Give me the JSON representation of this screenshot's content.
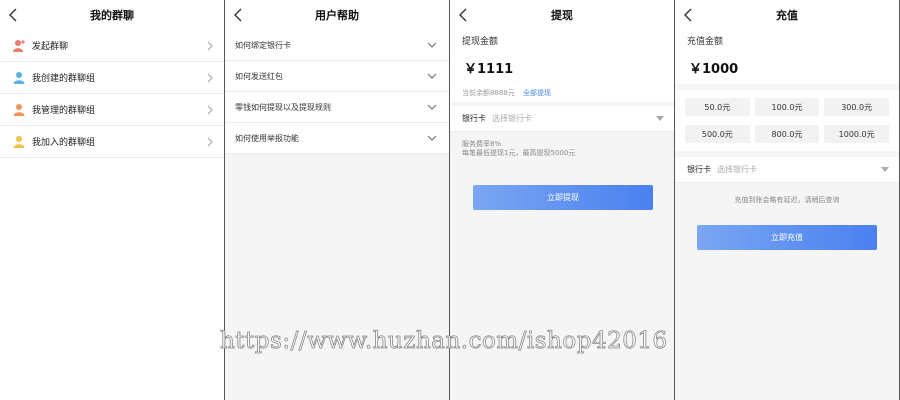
{
  "screens": {
    "my_groups": {
      "title": "我的群聊",
      "items": [
        {
          "label": "发起群聊",
          "icon": "user-add-icon",
          "color": "#e97b6a"
        },
        {
          "label": "我创建的群聊组",
          "icon": "user-icon",
          "color": "#5ab3e6"
        },
        {
          "label": "我管理的群聊组",
          "icon": "user-icon",
          "color": "#f0935a"
        },
        {
          "label": "我加入的群聊组",
          "icon": "user-icon",
          "color": "#f3c04a"
        }
      ]
    },
    "help": {
      "title": "用户帮助",
      "items": [
        {
          "label": "如何绑定银行卡"
        },
        {
          "label": "如何发送红包"
        },
        {
          "label": "零钱如何提现以及提现规则"
        },
        {
          "label": "如何使用举报功能"
        }
      ]
    },
    "withdraw": {
      "title": "提现",
      "amount_label": "提现金额",
      "amount_value": "￥1111",
      "balance_note": "当前余额8888元",
      "withdraw_all": "全部提现",
      "bank_label": "银行卡",
      "bank_placeholder": "选择银行卡",
      "fee_line1": "服务费率8%",
      "fee_line2": "每笔最低提现1元，最高提现5000元",
      "button": "立即提现"
    },
    "recharge": {
      "title": "充值",
      "amount_label": "充值金额",
      "amount_value": "￥1000",
      "options": [
        "50.0元",
        "100.0元",
        "300.0元",
        "500.0元",
        "800.0元",
        "1000.0元"
      ],
      "bank_label": "银行卡",
      "bank_placeholder": "选择银行卡",
      "note": "充值到账会略有延迟，请稍后查询",
      "button": "立即充值"
    }
  },
  "watermark": "https://www.huzhan.com/ishop42016",
  "colors": {
    "accent": "#4a80f0",
    "accent_light": "#7aa6f2",
    "link": "#4a86e8"
  }
}
